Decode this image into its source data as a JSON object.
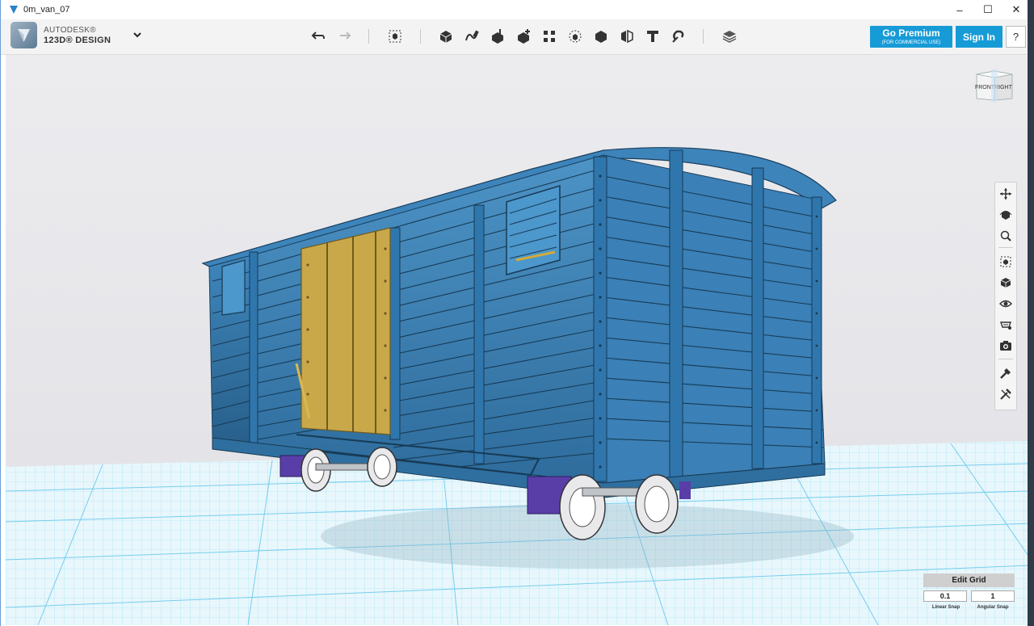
{
  "window": {
    "title": "0m_van_07",
    "min": "–",
    "max": "☐",
    "close": "✕"
  },
  "brand": {
    "line1": "AUTODESK®",
    "line2": "123D® DESIGN",
    "menu_icon": "chevron-down-icon"
  },
  "toolbar": {
    "tools": [
      "undo-icon",
      "redo-icon",
      "transform-icon",
      "primitives-icon",
      "sketch-icon",
      "construct-icon",
      "modify-icon",
      "pattern-icon",
      "grouping-icon",
      "combine-icon",
      "measure-icon",
      "text-icon",
      "snap-icon",
      "materials-icon"
    ],
    "premium_label": "Go Premium",
    "premium_sub": "(FOR COMMERCIAL USE)",
    "signin_label": "Sign In",
    "help_label": "?"
  },
  "viewcube": {
    "front": "FRONT",
    "right": "RIGHT"
  },
  "nav_tools": [
    "pan-icon",
    "orbit-icon",
    "zoom-icon",
    "fit-icon",
    "view-icon",
    "visibility-icon",
    "material-icon",
    "camera-icon",
    "snap-icon",
    "tools-icon"
  ],
  "edit_grid": {
    "title": "Edit Grid",
    "linear_value": "0.1",
    "angular_value": "1",
    "linear_label": "Linear Snap",
    "angular_label": "Angular Snap"
  },
  "colors": {
    "accent": "#179bd7",
    "van_body": "#3b7eb3",
    "door": "#c9a84a",
    "bogie": "#5a3ea8",
    "grid": "#7fd0f0"
  }
}
